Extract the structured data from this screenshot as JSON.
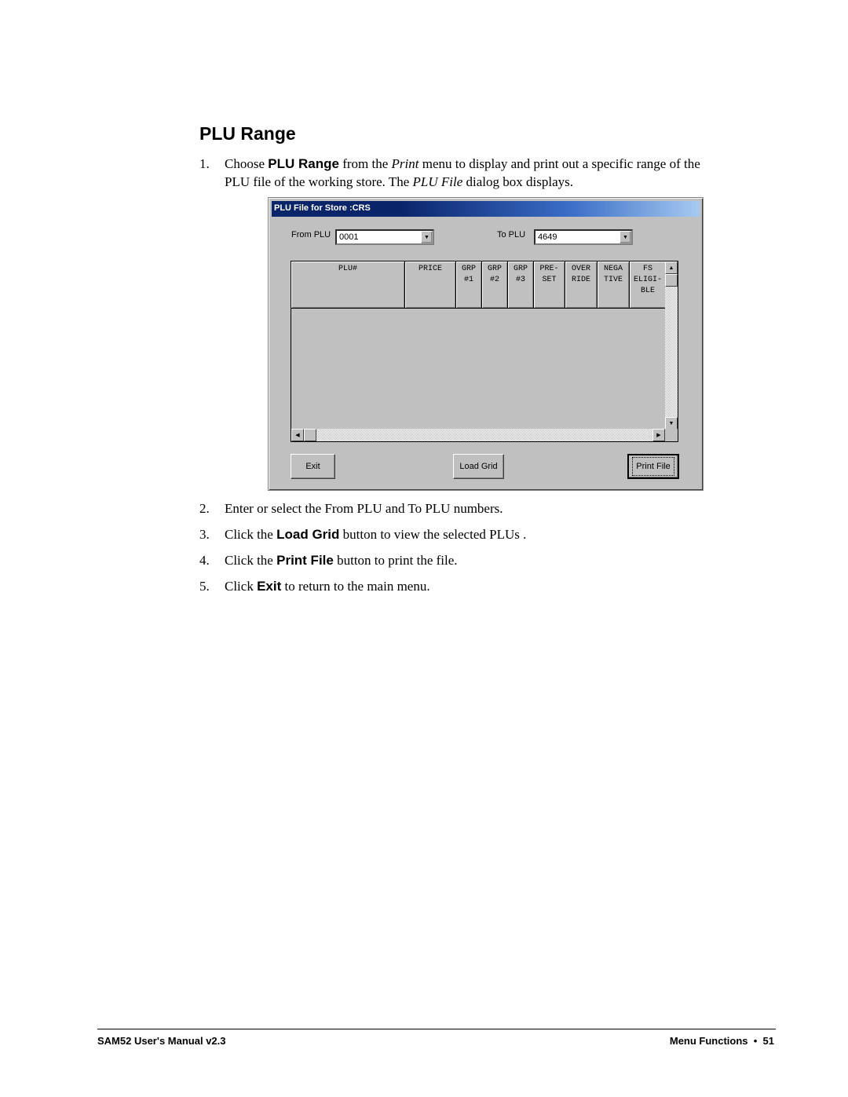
{
  "heading": "PLU Range",
  "steps": [
    {
      "num": "1.",
      "line1_a": "Choose ",
      "line1_b": "PLU Range",
      "line1_c": " from the ",
      "line1_d": "Print",
      "line1_e": " menu to display and print out a specific range of the",
      "line2_a": "PLU file of the working store.  The ",
      "line2_b": "PLU File",
      "line2_c": " dialog box displays."
    },
    {
      "num": "2.",
      "a": "Enter or select  the From PLU and To PLU numbers."
    },
    {
      "num": "3.",
      "a": "Click the ",
      "b": "Load Grid",
      "c": " button to view the selected PLUs ."
    },
    {
      "num": "4.",
      "a": "Click the ",
      "b": "Print File",
      "c": " button to print the file."
    },
    {
      "num": "5.",
      "a": "Click ",
      "b": "Exit",
      "c": " to return to the main menu."
    }
  ],
  "dialog": {
    "title": "PLU File for Store :CRS",
    "from_label": "From PLU",
    "from_value": "0001",
    "to_label": "To PLU",
    "to_value": "4649",
    "columns": [
      "PLU#",
      "PRICE",
      "GRP\n#1",
      "GRP\n#2",
      "GRP\n#3",
      "PRE-\nSET",
      "OVER\nRIDE",
      "NEGA\nTIVE",
      "FS\nELIGI-\nBLE"
    ],
    "buttons": {
      "exit": "Exit",
      "load_grid": "Load Grid",
      "print_file": "Print File"
    },
    "icons": {
      "dropdown": "▼",
      "up": "▲",
      "down": "▼",
      "left": "◀",
      "right": "▶"
    }
  },
  "footer": {
    "left": "SAM52 User's Manual v2.3",
    "right": "Menu Functions  •  51"
  }
}
